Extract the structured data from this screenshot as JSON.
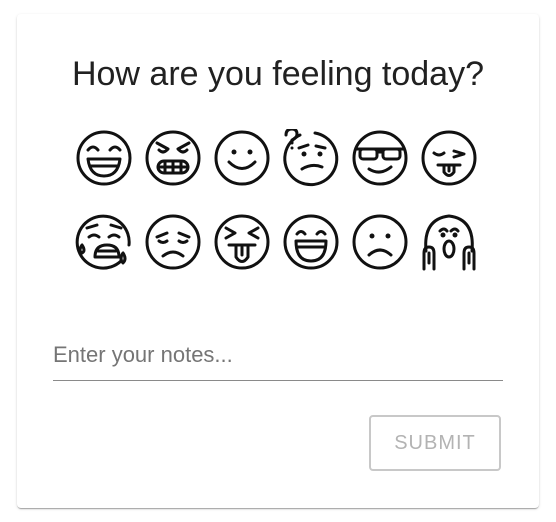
{
  "mood_card": {
    "title": "How are you feeling today?",
    "emojis": [
      {
        "name": "grinning-squint-icon"
      },
      {
        "name": "angry-grin-icon"
      },
      {
        "name": "smiling-icon"
      },
      {
        "name": "confused-question-icon"
      },
      {
        "name": "sunglasses-icon"
      },
      {
        "name": "winking-tongue-icon"
      },
      {
        "name": "crying-sad-icon"
      },
      {
        "name": "disappointed-icon"
      },
      {
        "name": "squinting-tongue-icon"
      },
      {
        "name": "grinning-open-icon"
      },
      {
        "name": "frowning-icon"
      },
      {
        "name": "screaming-fear-icon"
      }
    ],
    "notes_placeholder": "Enter your notes...",
    "notes_value": "",
    "submit_label": "SUBMIT"
  },
  "colors": {
    "text": "#212121",
    "icon_stroke": "#111111",
    "disabled": "#b3b3b3",
    "underline": "#8a8a8a"
  }
}
